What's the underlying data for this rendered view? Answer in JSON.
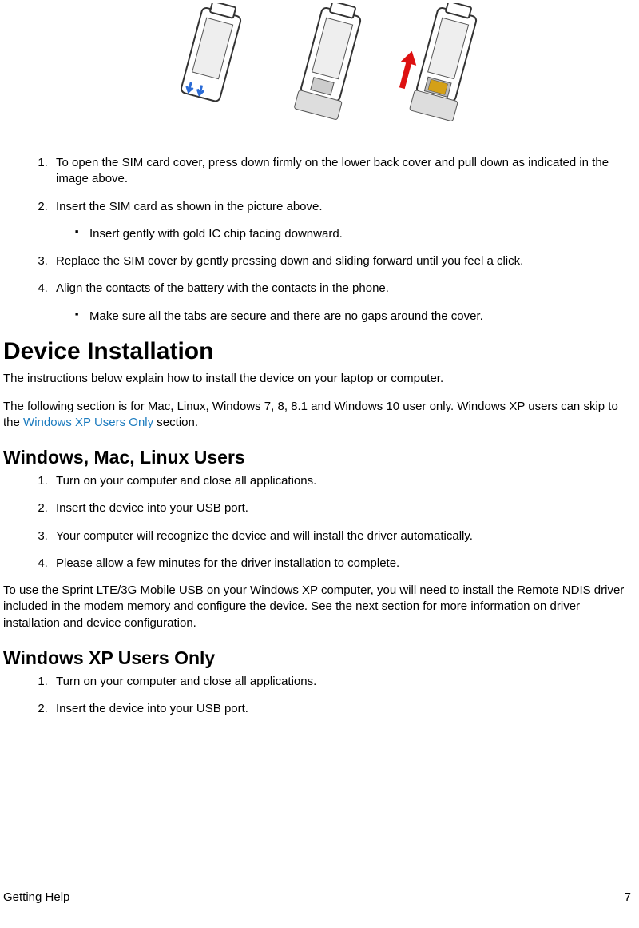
{
  "sim_steps": {
    "items": [
      {
        "text": "To open the SIM card cover, press down firmly on the lower back cover and pull down as indicated in the image above.",
        "sub": null
      },
      {
        "text": "Insert the SIM card as shown in the picture above.",
        "sub": "Insert gently with gold IC chip facing downward."
      },
      {
        "text": "Replace the SIM cover by gently pressing down and sliding forward until you feel a click.",
        "sub": null
      },
      {
        "text": "Align the contacts of the battery with the contacts in the phone.",
        "sub": "Make sure all the tabs are secure and there are no gaps around the cover."
      }
    ]
  },
  "heading1": "Device Installation",
  "intro_p1": "The instructions below explain how to install the device on your laptop or computer.",
  "intro_p2a": "The following section is for Mac, Linux, Windows 7, 8, 8.1 and Windows 10 user only.  Windows XP users can skip to the ",
  "intro_p2_link": "Windows XP Users Only",
  "intro_p2b": " section.",
  "heading2a": "Windows, Mac, Linux Users",
  "wml_steps": {
    "items": [
      "Turn on your computer and close all applications.",
      "Insert the device into your USB port.",
      "Your computer will recognize the device and will install the driver automatically.",
      "Please allow a few minutes for the driver installation to complete."
    ]
  },
  "para_ndis": "To use the Sprint LTE/3G Mobile USB on your Windows XP computer, you will need to install the Remote NDIS driver included in the modem memory and configure the device. See the next section for more information on driver installation and device configuration.",
  "heading2b": "Windows XP Users Only",
  "xp_steps": {
    "items": [
      "Turn on your computer and close all applications.",
      "Insert the device into your USB port."
    ]
  },
  "footer_left": "Getting Help",
  "footer_right": "7"
}
